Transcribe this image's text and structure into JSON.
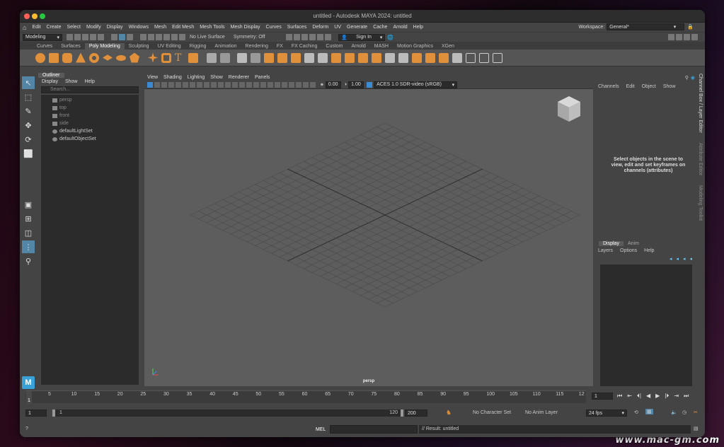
{
  "window": {
    "title": "untitled - Autodesk MAYA 2024: untitled"
  },
  "menubar": {
    "items": [
      "Edit",
      "Create",
      "Select",
      "Modify",
      "Display",
      "Windows",
      "Mesh",
      "Edit Mesh",
      "Mesh Tools",
      "Mesh Display",
      "Curves",
      "Surfaces",
      "Deform",
      "UV",
      "Generate",
      "Cache",
      "Arnold",
      "Help"
    ],
    "workspace_label": "Workspace:",
    "workspace_value": "General*"
  },
  "statusline": {
    "mode": "Modeling",
    "live_surface": "No Live Surface",
    "symmetry": "Symmetry: Off",
    "sign_in": "Sign In"
  },
  "shelf": {
    "tabs": [
      "Curves",
      "Surfaces",
      "Poly Modeling",
      "Sculpting",
      "UV Editing",
      "Rigging",
      "Animation",
      "Rendering",
      "FX",
      "FX Caching",
      "Custom",
      "Arnold",
      "MASH",
      "Motion Graphics",
      "XGen"
    ],
    "active_tab": "Poly Modeling",
    "icon_color": "#e0903a"
  },
  "outliner": {
    "title": "Outliner",
    "menu": [
      "Display",
      "Show",
      "Help"
    ],
    "search_placeholder": "Search...",
    "items": [
      "persp",
      "top",
      "front",
      "side",
      "defaultLightSet",
      "defaultObjectSet"
    ]
  },
  "viewport": {
    "menu": [
      "View",
      "Shading",
      "Lighting",
      "Show",
      "Renderer",
      "Panels"
    ],
    "exposure": "0.00",
    "gamma": "1.00",
    "color_space": "ACES 1.0 SDR-video (sRGB)",
    "camera_label": "persp"
  },
  "channelbox": {
    "menu": [
      "Channels",
      "Edit",
      "Object",
      "Show"
    ],
    "message": "Select objects in the scene to view, edit and set keyframes on channels (attributes)"
  },
  "layereditor": {
    "tabs": [
      "Display",
      "Anim"
    ],
    "menu": [
      "Layers",
      "Options",
      "Help"
    ]
  },
  "sidetabs": [
    "Channel Box / Layer Editor",
    "Attribute Editor",
    "Modeling Toolkit"
  ],
  "timeline": {
    "ticks": [
      "5",
      "10",
      "15",
      "20",
      "25",
      "30",
      "35",
      "40",
      "45",
      "50",
      "55",
      "60",
      "65",
      "70",
      "75",
      "80",
      "85",
      "90",
      "95",
      "100",
      "105",
      "110",
      "115",
      "12"
    ],
    "current_frame": "1",
    "start": "1"
  },
  "range": {
    "start": "1",
    "inner_start": "1",
    "inner_end": "120",
    "end": "200",
    "character_set": "No Character Set",
    "anim_layer": "No Anim Layer",
    "fps": "24 fps"
  },
  "cmdline": {
    "lang": "MEL",
    "result": "// Result: untitled"
  },
  "watermark": "www.mac-gm.com"
}
